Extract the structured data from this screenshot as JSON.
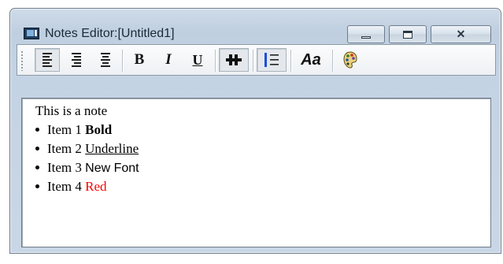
{
  "window": {
    "title": "Notes Editor:[Untitled1]",
    "caption_buttons": {
      "minimize_icon": "minimize-icon",
      "maximize_icon": "maximize-icon",
      "close_glyph": "✕"
    }
  },
  "toolbar": {
    "buttons": [
      {
        "name": "align-left-button",
        "icon": "align-left-icon",
        "pressed": true
      },
      {
        "name": "align-right-button",
        "icon": "align-right-icon",
        "pressed": false
      },
      {
        "name": "align-center-button",
        "icon": "align-center-icon",
        "pressed": false
      },
      {
        "name": "bold-button",
        "glyph": "B",
        "pressed": false
      },
      {
        "name": "italic-button",
        "glyph": "I",
        "pressed": false
      },
      {
        "name": "underline-button",
        "glyph": "U",
        "pressed": false
      },
      {
        "name": "strikeout-button",
        "icon": "strikeout-icon",
        "pressed": true
      },
      {
        "name": "bullets-button",
        "icon": "bullet-list-icon",
        "pressed": true
      },
      {
        "name": "font-button",
        "glyph": "Aa",
        "pressed": false
      },
      {
        "name": "color-button",
        "icon": "color-palette-icon",
        "pressed": false
      }
    ],
    "bold_glyph": "B",
    "italic_glyph": "I",
    "underline_glyph": "U",
    "font_glyph": "Aa"
  },
  "editor": {
    "first_line": "This is a note",
    "items": [
      {
        "prefix": "Item 1 ",
        "styled": "Bold",
        "style": "bold"
      },
      {
        "prefix": "Item 2 ",
        "styled": "Underline",
        "style": "underline"
      },
      {
        "prefix": "Item 3 ",
        "styled": "New Font",
        "style": "sans"
      },
      {
        "prefix": "Item 4 ",
        "styled": "Red",
        "style": "red"
      }
    ],
    "colors": {
      "red_text": "#ff0000"
    }
  }
}
